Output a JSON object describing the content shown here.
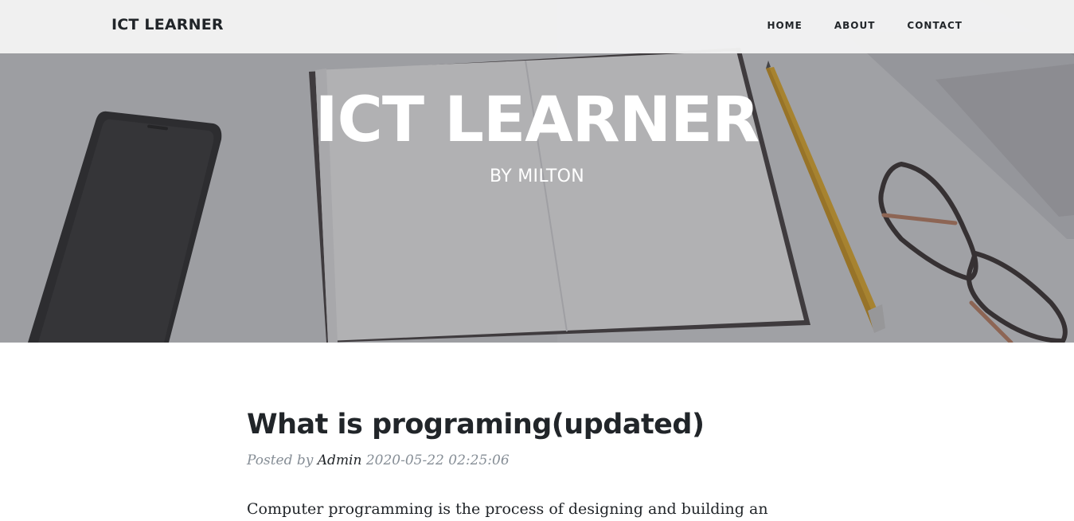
{
  "navbar": {
    "brand": "ICT LEARNER",
    "links": [
      {
        "label": "HOME"
      },
      {
        "label": "ABOUT"
      },
      {
        "label": "CONTACT"
      }
    ]
  },
  "hero": {
    "title": "ICT LEARNER",
    "subtitle": "BY MILTON"
  },
  "post": {
    "title": "What is programing(updated)",
    "meta_prefix": "Posted by",
    "author": "Admin",
    "date": "2020-05-22 02:25:06",
    "body": "Computer programming is the process of designing and building an"
  },
  "colors": {
    "text_dark": "#212529",
    "meta_gray": "#868e96",
    "navbar_bg": "#f4f4f4"
  }
}
